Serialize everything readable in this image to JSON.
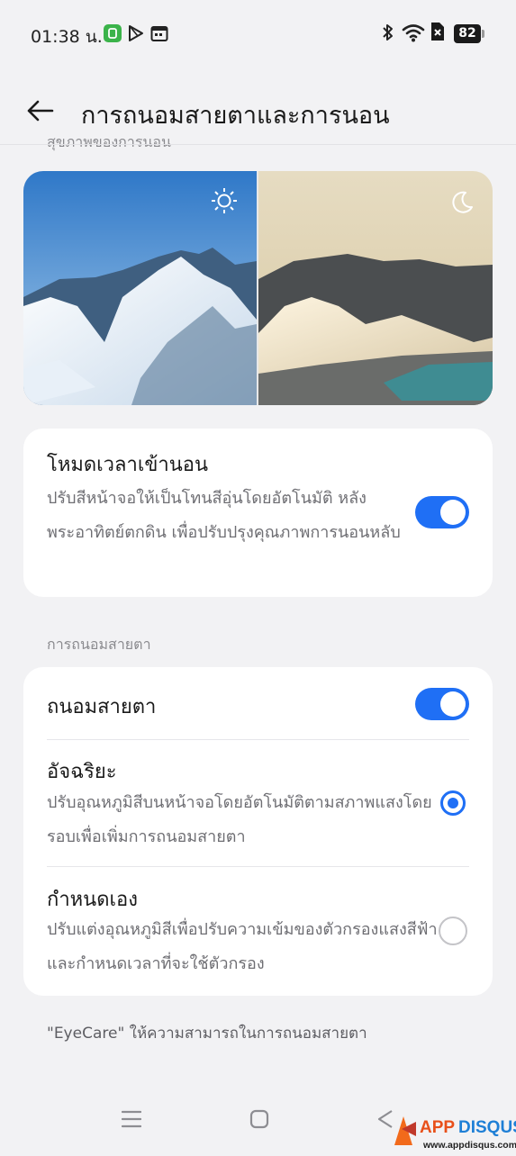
{
  "status_bar": {
    "time": "01:38 น.",
    "battery": "82",
    "left_icons": [
      "line-app-icon",
      "play-store-icon",
      "calendar-icon"
    ],
    "right_icons": [
      "bluetooth-icon",
      "wifi-icon",
      "no-sim-icon",
      "battery-icon"
    ]
  },
  "header": {
    "title": "การถนอมสายตาและการนอน",
    "clipped_section_label": "สุขภาพของการนอน"
  },
  "preview": {
    "left_icon": "sun-icon",
    "right_icon": "moon-icon"
  },
  "bedtime_mode": {
    "title": "โหมดเวลาเข้านอน",
    "description": "ปรับสีหน้าจอให้เป็นโทนสีอุ่นโดยอัตโนมัติ หลังพระอาทิตย์ตกดิน เพื่อปรับปรุงคุณภาพการนอนหลับ",
    "enabled": true
  },
  "eye_comfort": {
    "section_label": "การถนอมสายตา",
    "toggle_label": "ถนอมสายตา",
    "enabled": true,
    "options": [
      {
        "title": "อัจฉริยะ",
        "description": "ปรับอุณหภูมิสีบนหน้าจอโดยอัตโนมัติตามสภาพแสงโดยรอบเพื่อเพิ่มการถนอมสายตา",
        "selected": true
      },
      {
        "title": "กำหนดเอง",
        "description": "ปรับแต่งอุณหภูมิสีเพื่อปรับความเข้มของตัวกรองแสงสีฟ้า และกำหนดเวลาที่จะใช้ตัวกรอง",
        "selected": false
      }
    ]
  },
  "footer_note": "\"EyeCare\" ให้ความสามารถในการถนอมสายตา",
  "navigation_bar": {
    "buttons": [
      "menu-icon",
      "home-icon",
      "back-icon"
    ]
  },
  "watermark": {
    "brand": "APPDISQUS",
    "url": "www.appdisqus.com"
  },
  "colors": {
    "accent": "#1f6ff5",
    "background": "#f2f2f4",
    "card": "#ffffff"
  }
}
